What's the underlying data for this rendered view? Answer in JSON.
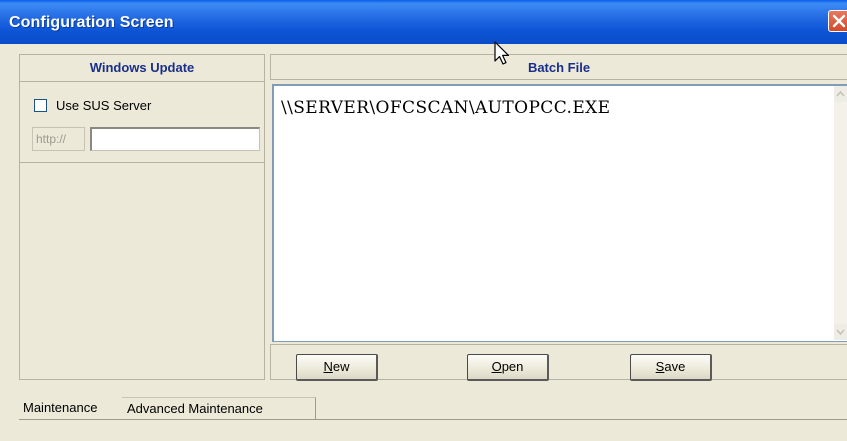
{
  "window": {
    "title": "Configuration Screen",
    "close_icon": "close-icon"
  },
  "windows_update": {
    "header": "Windows Update",
    "use_sus_label": "Use SUS Server",
    "use_sus_checked": false,
    "url_prefix": "http://",
    "url_value": ""
  },
  "batch_file": {
    "header": "Batch File",
    "content": "\\\\SERVER\\OFCSCAN\\AUTOPCC.EXE"
  },
  "buttons": {
    "new": {
      "accel": "N",
      "rest": "ew"
    },
    "open": {
      "accel": "O",
      "rest": "pen"
    },
    "save": {
      "accel": "S",
      "rest": "ave"
    }
  },
  "tabs": {
    "maintenance": "Maintenance",
    "advanced": "Advanced Maintenance"
  },
  "colors": {
    "title_bar": "#0a5ee8",
    "panel_bg": "#ece9d8",
    "header_text": "#1a2f8c"
  }
}
